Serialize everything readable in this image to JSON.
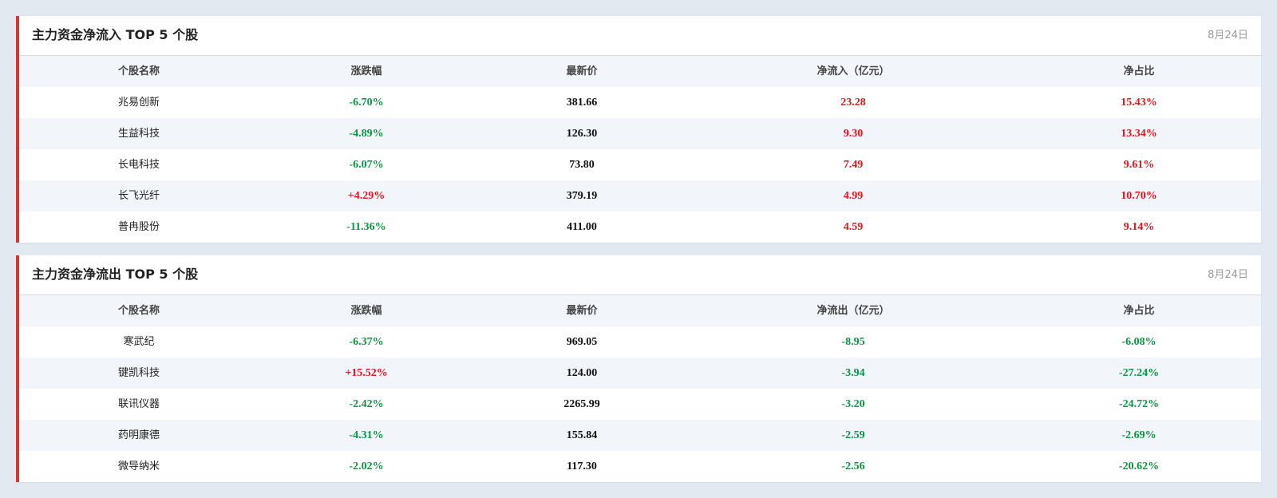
{
  "colors": {
    "accent": "#e0312b",
    "up": "#e0161d",
    "down": "#0a9443",
    "background": "#e3e9f1",
    "stripe": "#f2f5f9"
  },
  "inflow": {
    "title": "主力资金净流入 TOP 5 个股",
    "date": "8月24日",
    "headers": [
      "个股名称",
      "涨跌幅",
      "最新价",
      "净流入（亿元）",
      "净占比"
    ],
    "rows": [
      {
        "name": "兆易创新",
        "change": "-6.70%",
        "price": "381.66",
        "flow": "23.28",
        "ratio": "15.43%"
      },
      {
        "name": "生益科技",
        "change": "-4.89%",
        "price": "126.30",
        "flow": "9.30",
        "ratio": "13.34%"
      },
      {
        "name": "长电科技",
        "change": "-6.07%",
        "price": "73.80",
        "flow": "7.49",
        "ratio": "9.61%"
      },
      {
        "name": "长飞光纤",
        "change": "+4.29%",
        "price": "379.19",
        "flow": "4.99",
        "ratio": "10.70%"
      },
      {
        "name": "普冉股份",
        "change": "-11.36%",
        "price": "411.00",
        "flow": "4.59",
        "ratio": "9.14%"
      }
    ]
  },
  "outflow": {
    "title": "主力资金净流出 TOP 5 个股",
    "date": "8月24日",
    "headers": [
      "个股名称",
      "涨跌幅",
      "最新价",
      "净流出（亿元）",
      "净占比"
    ],
    "rows": [
      {
        "name": "寒武纪",
        "change": "-6.37%",
        "price": "969.05",
        "flow": "-8.95",
        "ratio": "-6.08%"
      },
      {
        "name": "键凯科技",
        "change": "+15.52%",
        "price": "124.00",
        "flow": "-3.94",
        "ratio": "-27.24%"
      },
      {
        "name": "联讯仪器",
        "change": "-2.42%",
        "price": "2265.99",
        "flow": "-3.20",
        "ratio": "-24.72%"
      },
      {
        "name": "药明康德",
        "change": "-4.31%",
        "price": "155.84",
        "flow": "-2.59",
        "ratio": "-2.69%"
      },
      {
        "name": "微导纳米",
        "change": "-2.02%",
        "price": "117.30",
        "flow": "-2.56",
        "ratio": "-20.62%"
      }
    ]
  }
}
